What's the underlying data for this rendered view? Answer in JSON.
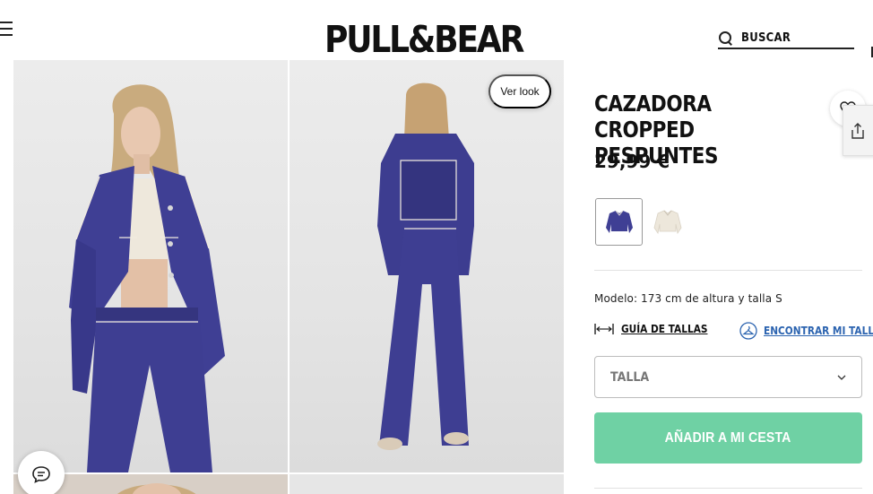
{
  "header": {
    "logo": "PULL&BEAR",
    "search_label": "BUSCAR"
  },
  "gallery": {
    "ver_look_label": "Ver look"
  },
  "product": {
    "title": "CAZADORA CROPPED PESPUNTES",
    "price": "29,99 €",
    "model_info": "Modelo: 173 cm de altura y talla S",
    "size_guide_label": "GUÍA DE TALLAS",
    "find_size_label": "ENCONTRAR MI TALLA",
    "size_select_placeholder": "TALLA",
    "add_to_cart_label": "AÑADIR A MI CESTA"
  },
  "colors": {
    "accent_button": "#6fd1a4",
    "link_blue": "#2c64b0",
    "denim": "#3f3f94",
    "swatch_ecru": "#ede7db"
  },
  "icons": [
    "menu-icon",
    "search-icon",
    "heart-icon",
    "share-icon",
    "chat-icon",
    "ruler-icon",
    "hanger-icon",
    "chevron-down-icon"
  ]
}
